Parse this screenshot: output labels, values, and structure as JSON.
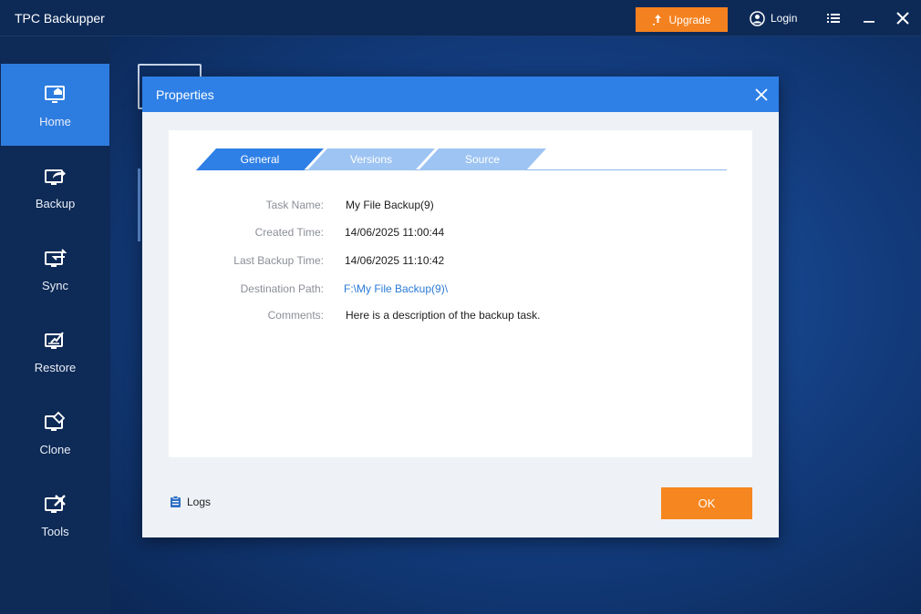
{
  "app": {
    "title": "TPC Backupper"
  },
  "titlebar": {
    "upgrade_label": "Upgrade",
    "login_label": "Login",
    "menu_icon": "list-menu-icon",
    "minimize_icon": "minimize-icon",
    "close_icon": "close-icon",
    "upgrade_color": "#f4811f"
  },
  "sidebar": {
    "items": [
      {
        "label": "Home",
        "icon": "home-monitor-icon",
        "active": true
      },
      {
        "label": "Backup",
        "icon": "backup-monitor-icon",
        "active": false
      },
      {
        "label": "Sync",
        "icon": "sync-monitor-icon",
        "active": false
      },
      {
        "label": "Restore",
        "icon": "restore-monitor-icon",
        "active": false
      },
      {
        "label": "Clone",
        "icon": "clone-monitor-icon",
        "active": false
      },
      {
        "label": "Tools",
        "icon": "tools-monitor-icon",
        "active": false
      }
    ],
    "active_color": "#2d7ce0"
  },
  "dialog": {
    "title": "Properties",
    "tabs": [
      {
        "label": "General",
        "active": true
      },
      {
        "label": "Versions",
        "active": false
      },
      {
        "label": "Source",
        "active": false
      }
    ],
    "fields": {
      "task_name": {
        "label": "Task Name:",
        "value": "My File Backup(9)"
      },
      "created_time": {
        "label": "Created Time:",
        "value": "14/06/2025 11:00:44"
      },
      "last_backup_time": {
        "label": "Last Backup Time:",
        "value": "14/06/2025 11:10:42"
      },
      "destination_path": {
        "label": "Destination Path:",
        "value": "F:\\My File Backup(9)\\"
      },
      "comments": {
        "label": "Comments:",
        "value": "Here is a description of the backup task."
      }
    },
    "logs_label": "Logs",
    "ok_label": "OK",
    "header_color": "#2e80e6",
    "ok_color": "#f6861f"
  }
}
